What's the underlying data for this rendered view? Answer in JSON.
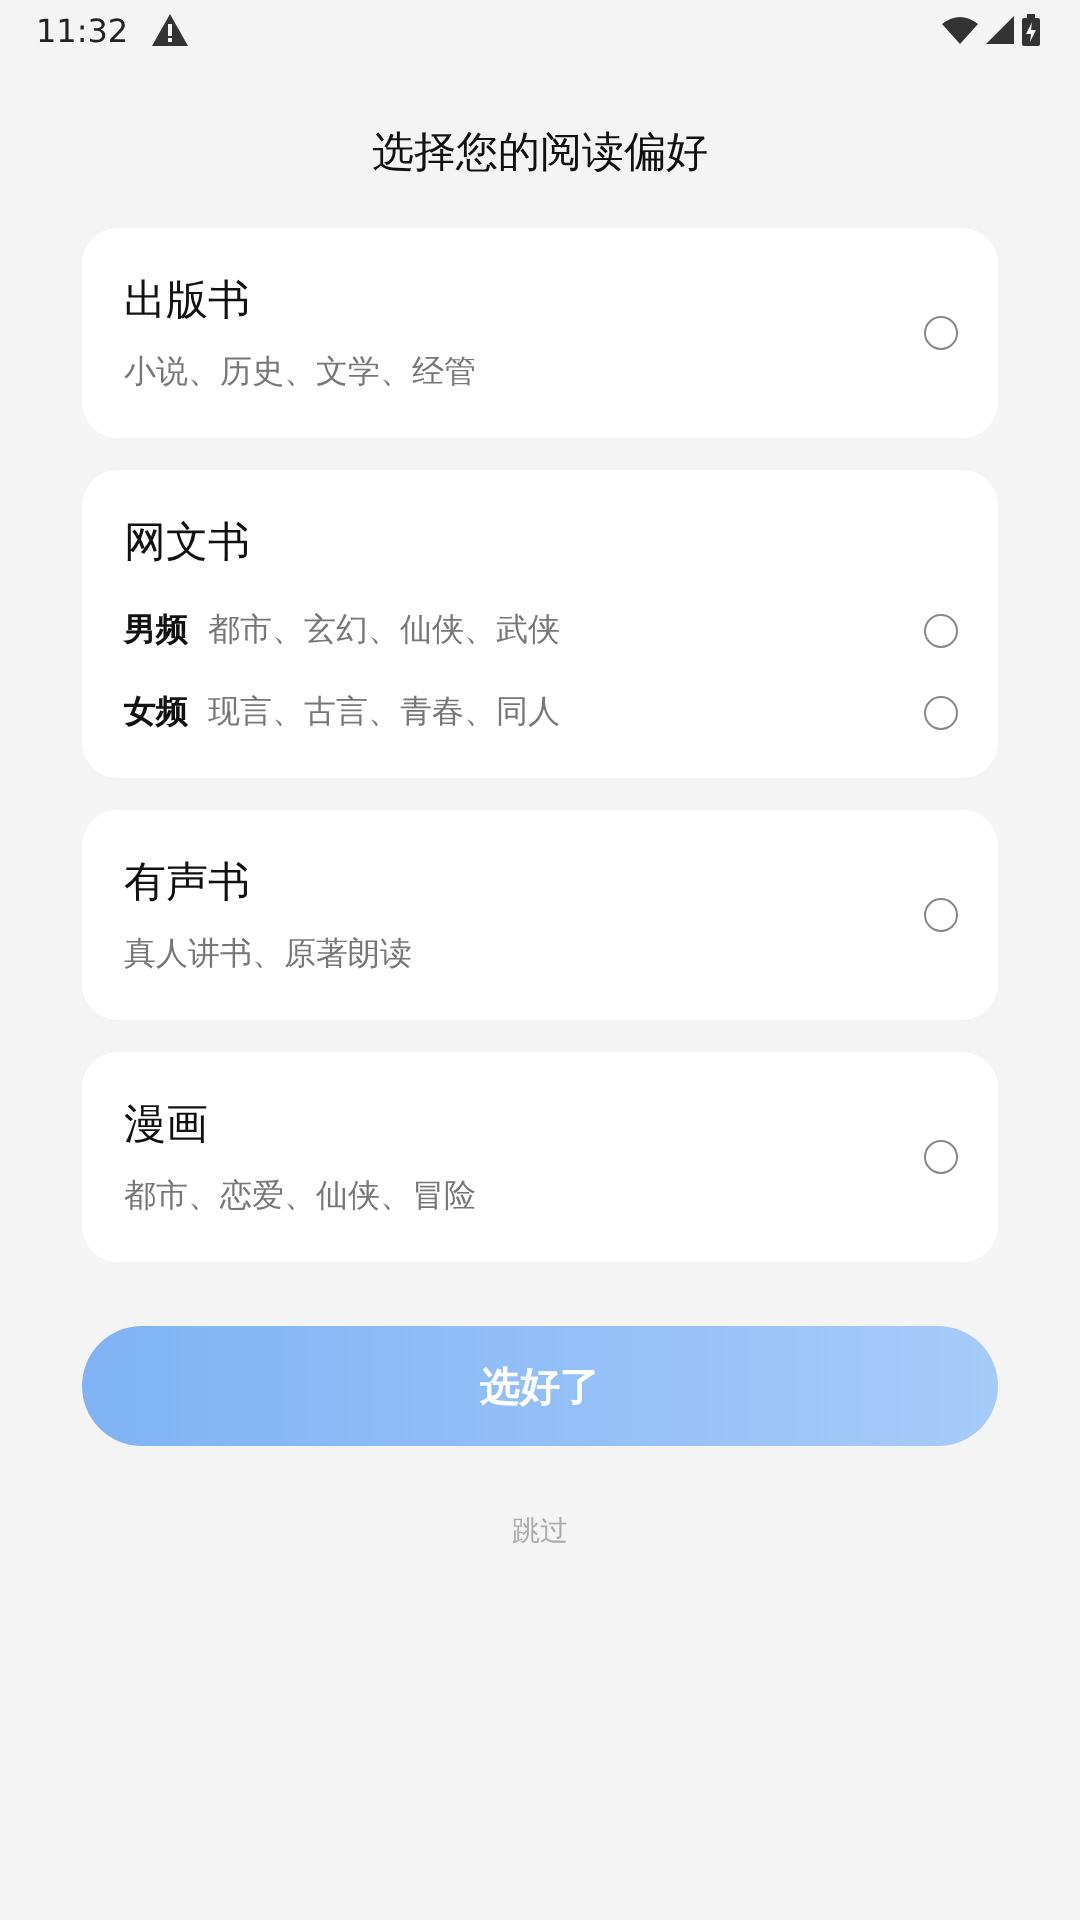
{
  "status_bar": {
    "time": "11:32"
  },
  "title": "选择您的阅读偏好",
  "categories": [
    {
      "kind": "simple",
      "name": "出版书",
      "description": "小说、历史、文学、经管",
      "selected": false
    },
    {
      "kind": "grouped",
      "name": "网文书",
      "options": [
        {
          "label": "男频",
          "description": "都市、玄幻、仙侠、武侠",
          "selected": false
        },
        {
          "label": "女频",
          "description": "现言、古言、青春、同人",
          "selected": false
        }
      ]
    },
    {
      "kind": "simple",
      "name": "有声书",
      "description": "真人讲书、原著朗读",
      "selected": false
    },
    {
      "kind": "simple",
      "name": "漫画",
      "description": "都市、恋爱、仙侠、冒险",
      "selected": false
    }
  ],
  "confirm_button": {
    "label": "选好了",
    "disabled": true
  },
  "skip_link": "跳过"
}
